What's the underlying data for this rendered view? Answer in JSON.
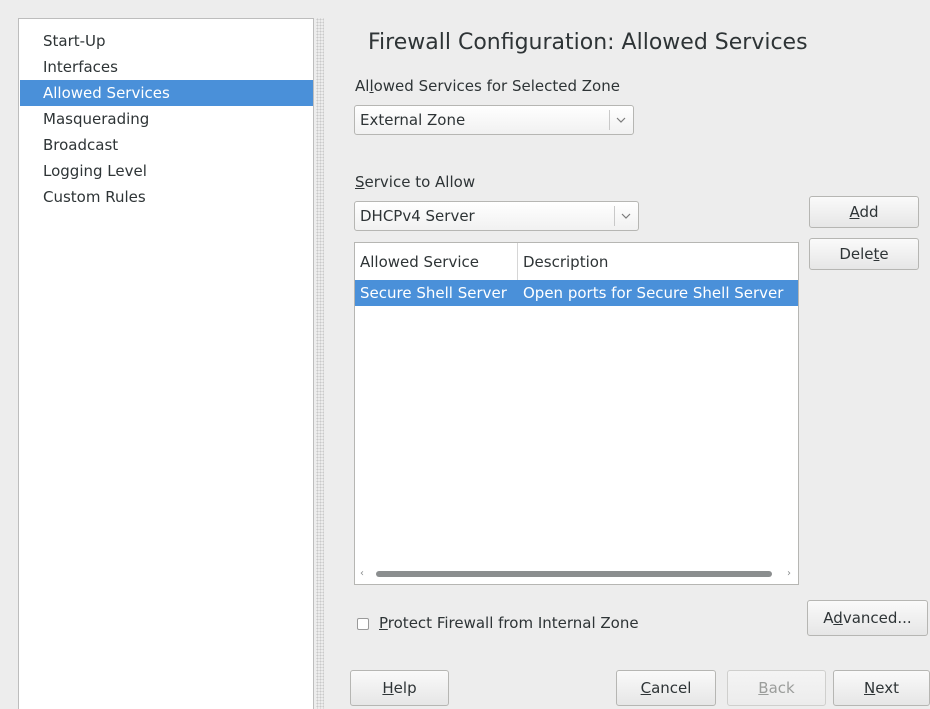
{
  "sidebar": {
    "items": [
      {
        "label": "Start-Up"
      },
      {
        "label": "Interfaces"
      },
      {
        "label": "Allowed Services",
        "selected": true
      },
      {
        "label": "Masquerading"
      },
      {
        "label": "Broadcast"
      },
      {
        "label": "Logging Level"
      },
      {
        "label": "Custom Rules"
      }
    ]
  },
  "page": {
    "title": "Firewall Configuration: Allowed Services"
  },
  "zone": {
    "label_pre": "Al",
    "label_mnemonic": "l",
    "label_post": "owed Services for Selected Zone",
    "value": "External Zone"
  },
  "service": {
    "label_mnemonic": "S",
    "label_post": "ervice to Allow",
    "value": "DHCPv4 Server"
  },
  "buttons": {
    "add_mnemonic": "A",
    "add_post": "dd",
    "delete_pre": "Dele",
    "delete_mnemonic": "t",
    "delete_post": "e",
    "advanced_pre": "A",
    "advanced_mnemonic": "d",
    "advanced_post": "vanced...",
    "help_mnemonic": "H",
    "help_post": "elp",
    "cancel_mnemonic": "C",
    "cancel_post": "ancel",
    "back_mnemonic": "B",
    "back_post": "ack",
    "next_mnemonic": "N",
    "next_post": "ext"
  },
  "table": {
    "columns": [
      "Allowed Service",
      "Description"
    ],
    "rows": [
      {
        "service": "Secure Shell Server",
        "description": "Open ports for Secure Shell Server",
        "selected": true
      }
    ]
  },
  "protect": {
    "label_mnemonic": "P",
    "label_post": "rotect Firewall from Internal Zone",
    "checked": false
  },
  "colors": {
    "selection": "#4a90d9",
    "window_bg": "#ededed"
  },
  "icons": {
    "combo_arrow": "chevron-down-icon",
    "scroll_left": "scroll-left-arrow-icon",
    "scroll_right": "scroll-right-arrow-icon"
  }
}
